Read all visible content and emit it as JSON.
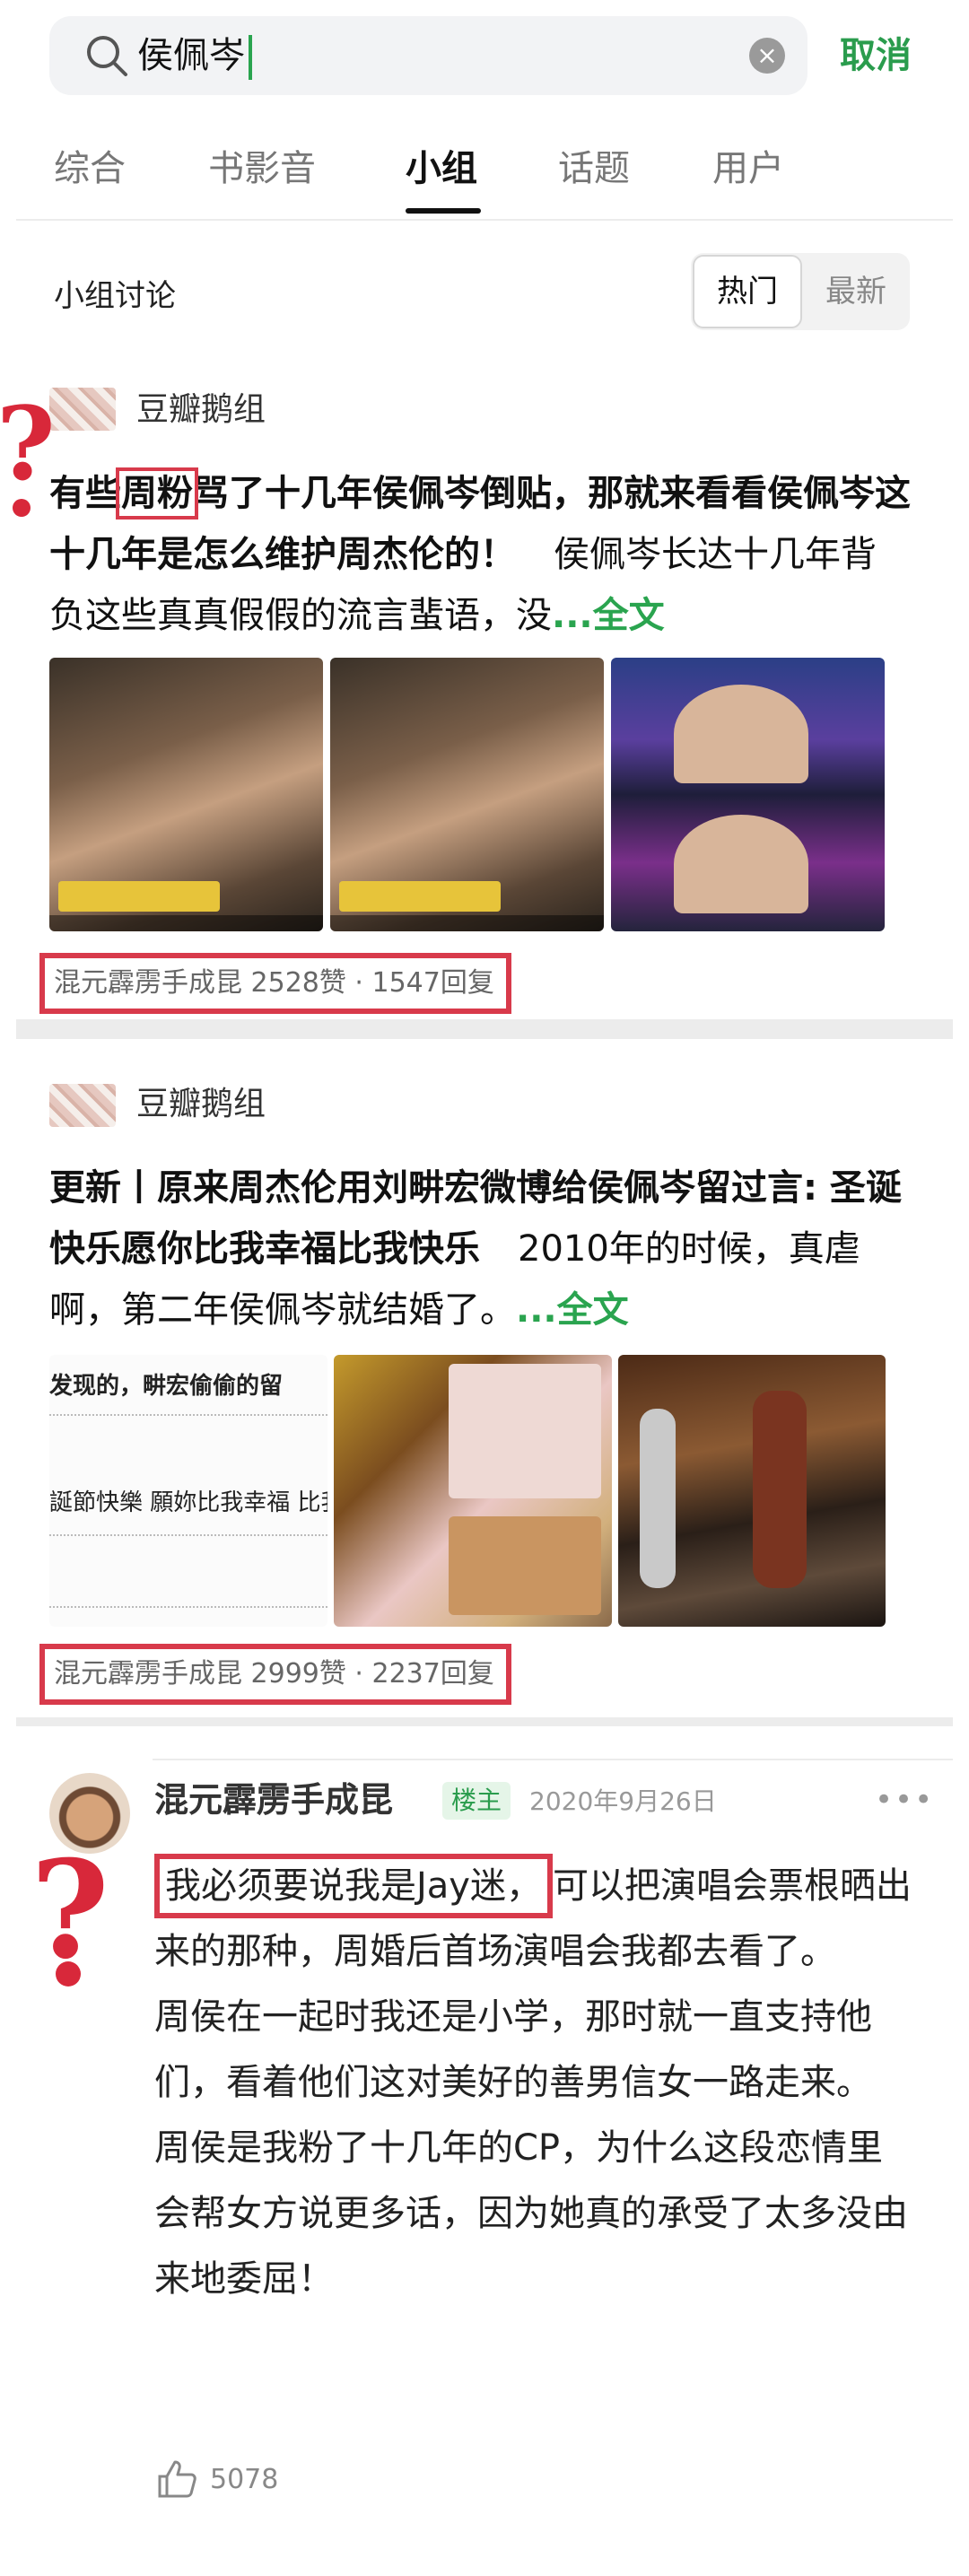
{
  "search": {
    "query": "侯佩岑",
    "cancel_label": "取消"
  },
  "tabs": [
    {
      "label": "综合"
    },
    {
      "label": "书影音"
    },
    {
      "label": "小组"
    },
    {
      "label": "话题"
    },
    {
      "label": "用户"
    }
  ],
  "section": {
    "title": "小组讨论",
    "sort_hot": "热门",
    "sort_new": "最新"
  },
  "posts": [
    {
      "group": "豆瓣鹅组",
      "title_pre": "有些",
      "title_highlight": "周粉",
      "title_post": "骂了十几年侯佩岑倒贴，那就来看看侯佩岑这十几年是怎么维护周杰伦的！",
      "excerpt": "侯佩岑长达十几年背负这些真真假假的流言蜚语，没",
      "more": "...全文",
      "meta": "混元霹雳手成昆 2528赞 · 1547回复"
    },
    {
      "group": "豆瓣鹅组",
      "title": "更新丨原来周杰伦用刘畊宏微博给侯佩岑留过言: 圣诞快乐愿你比我幸福比我快乐",
      "excerpt": "2010年的时候，真虐啊，第二年侯佩岑就结婚了。",
      "more": "...全文",
      "image_text_1": "发现的，畊宏偷偷的留",
      "image_text_2": "誕節快樂 願妳比我幸福 比我",
      "meta": "混元霹雳手成昆 2999赞 · 2237回复"
    }
  ],
  "comment": {
    "username": "混元霹雳手成昆",
    "badge": "楼主",
    "date": "2020年9月26日",
    "highlight": "我必须要说我是Jay迷，",
    "body_1": "可以把演唱会票根晒出来的那种，周婚后首场演唱会我都去看了。",
    "body_2": "周侯在一起时我还是小学，那时就一直支持他们，看着他们这对美好的善男信女一路走来。",
    "body_3": "周侯是我粉了十几年的CP，为什么这段恋情里会帮女方说更多话，因为她真的承受了太多没由来地委屈！",
    "likes": "5078"
  },
  "icons": {
    "search": "search-icon",
    "clear": "clear-icon",
    "like": "thumbs-up-icon",
    "more": "more-dots-icon"
  },
  "colors": {
    "accent_green": "#2aa44f",
    "annotation_red": "#d83a4b"
  }
}
